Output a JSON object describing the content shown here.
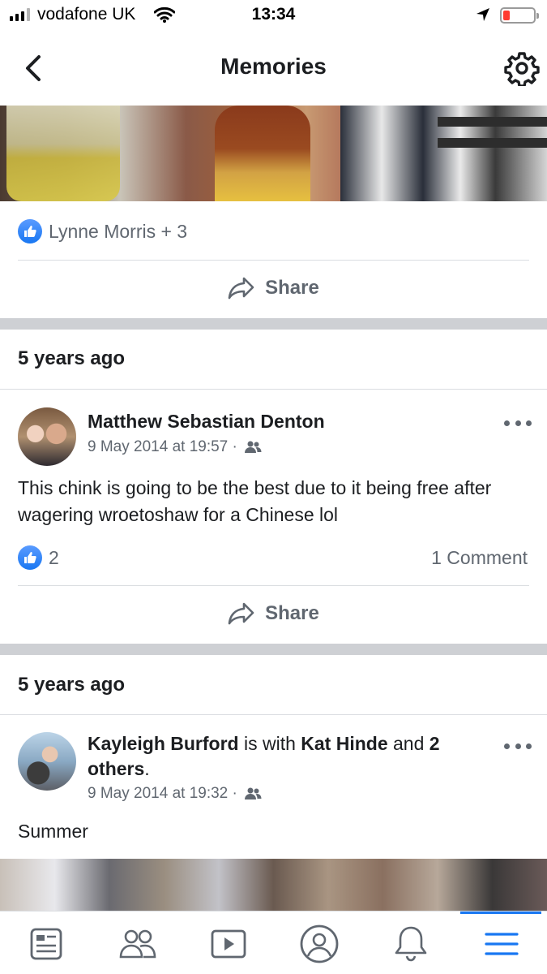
{
  "status_bar": {
    "carrier": "vodafone UK",
    "time": "13:34"
  },
  "header": {
    "title": "Memories"
  },
  "post_top": {
    "likes_text": "Lynne Morris + 3",
    "share_label": "Share"
  },
  "post1": {
    "section_title": "5 years ago",
    "author": "Matthew Sebastian Denton",
    "date": "9 May 2014 at 19:57 ·",
    "text": "This chink is going to be the best due to it being free after wagering wroetoshaw for a Chinese lol",
    "like_count": "2",
    "comments": "1 Comment",
    "share_label": "Share"
  },
  "post2": {
    "section_title": "5 years ago",
    "author": "Kayleigh Burford",
    "with_text": "is with",
    "tagged": "Kat Hinde",
    "and_text": "and",
    "others": "2 others",
    "period": ".",
    "date": "9 May 2014 at 19:32 ·",
    "text": "Summer"
  },
  "colors": {
    "accent": "#1877f2",
    "secondary_text": "#606770",
    "divider": "#ced0d4"
  },
  "tab_bar": {
    "icons": [
      "news-feed-icon",
      "friends-icon",
      "watch-icon",
      "profile-icon",
      "notifications-icon",
      "menu-icon"
    ],
    "active": "menu-icon"
  }
}
